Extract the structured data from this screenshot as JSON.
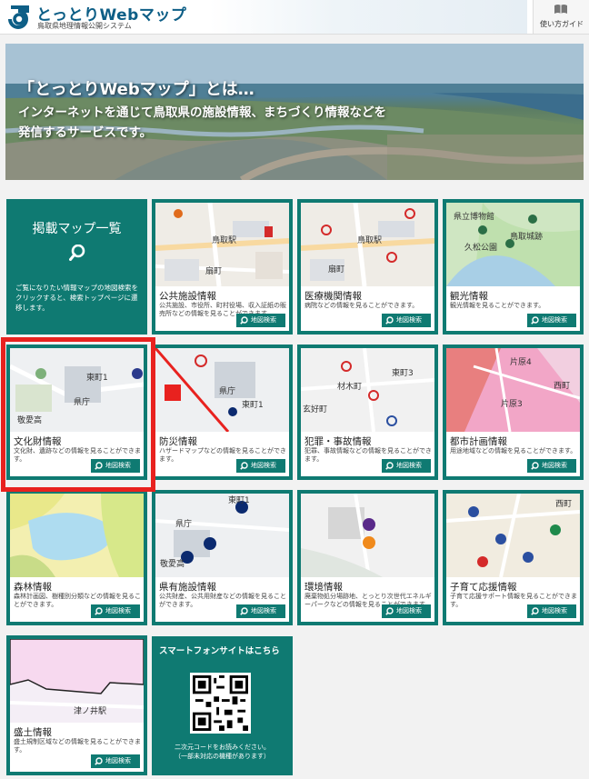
{
  "header": {
    "logo_title": "とっとりWebマップ",
    "logo_subtitle": "鳥取県地理情報公開システム",
    "guide_label": "使い方ガイド"
  },
  "hero": {
    "title": "「とっとりWebマップ」とは…",
    "line1": "インターネットを通じて鳥取県の施設情報、まちづくり情報などを",
    "line2": "発信するサービスです。"
  },
  "intro": {
    "title": "掲載マップ一覧",
    "text": "ご覧になりたい情報マップの地図検索をクリックすると、検索トップページに遷移します。"
  },
  "search_label": "地図検索",
  "cards": [
    {
      "title": "公共施設情報",
      "desc": "公共施設、市役所、町村役場、収入証紙の販売所などの情報を見ることができます。",
      "map_labels": [
        "鳥取駅",
        "扇町"
      ]
    },
    {
      "title": "医療機関情報",
      "desc": "病院などの情報を見ることができます。",
      "map_labels": [
        "鳥取駅",
        "扇町"
      ]
    },
    {
      "title": "観光情報",
      "desc": "観光情報を見ることができます。",
      "map_labels": [
        "県立博物館",
        "久松公園",
        "鳥取城跡"
      ]
    },
    {
      "title": "文化財情報",
      "desc": "文化財、遺跡などの情報を見ることができます。",
      "map_labels": [
        "東町1",
        "県庁",
        "敬愛高"
      ]
    },
    {
      "title": "防災情報",
      "desc": "ハザードマップなどの情報を見ることができます。",
      "map_labels": [
        "東町1",
        "県庁"
      ]
    },
    {
      "title": "犯罪・事故情報",
      "desc": "犯罪、事故情報などの情報を見ることができます。",
      "map_labels": [
        "東町3",
        "材木町",
        "玄好町"
      ]
    },
    {
      "title": "都市計画情報",
      "desc": "用途地域などの情報を見ることができます。",
      "map_labels": [
        "片原4",
        "片原3",
        "西町"
      ]
    },
    {
      "title": "森林情報",
      "desc": "森林計画図、樹種別分類などの情報を見ることができます。",
      "map_labels": []
    },
    {
      "title": "県有施設情報",
      "desc": "公共財産、公共用財産などの情報を見ることができます。",
      "map_labels": [
        "東町1",
        "県庁",
        "敬愛高"
      ]
    },
    {
      "title": "環境情報",
      "desc": "廃棄物処分場跡地、とっとり次世代エネルギーパークなどの情報を見ることができます。",
      "map_labels": []
    },
    {
      "title": "子育て応援情報",
      "desc": "子育て応援サポート情報を見ることができます。",
      "map_labels": [
        "西町"
      ]
    },
    {
      "title": "盛土情報",
      "desc": "盛土規制区域などの情報を見ることができます。",
      "map_labels": [
        "津ノ井駅"
      ]
    }
  ],
  "smartphone": {
    "title": "スマートフォンサイトはこちら",
    "note_line1": "二次元コードをお読みください。",
    "note_line2": "（一部未対応の機種があります）"
  },
  "colors": {
    "accent_teal": "#0f7a72",
    "highlight_red": "#e8221f",
    "logo_blue": "#0d5e86"
  }
}
